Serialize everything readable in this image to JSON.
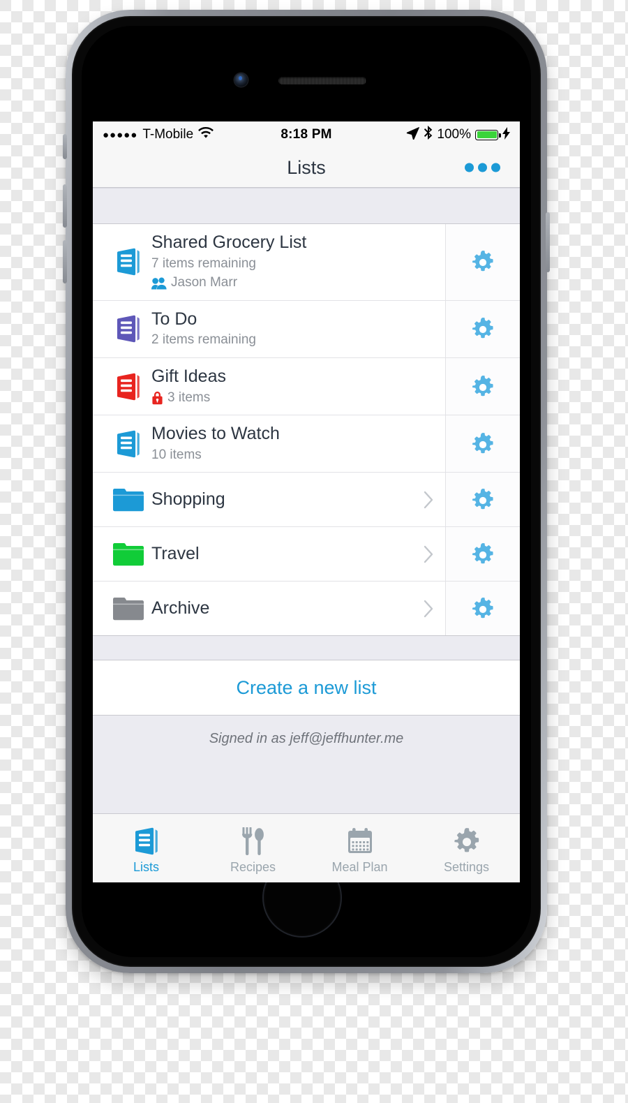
{
  "device": {
    "name": "iPhone",
    "camera_icon": "front-camera",
    "speaker_icon": "earpiece-speaker",
    "home_button_icon": "home-button"
  },
  "status_bar": {
    "signal_dots": "●●●●●",
    "carrier": "T-Mobile",
    "wifi_icon": "wifi-icon",
    "time": "8:18 PM",
    "location_icon": "location-arrow-icon",
    "bluetooth_icon": "bluetooth-icon",
    "battery_percent": "100%",
    "battery_level": 100,
    "battery_color": "#3ad43a",
    "charging_icon": "lightning-bolt-icon"
  },
  "nav_bar": {
    "title": "Lists",
    "more_button_label": "•••",
    "more_icon": "ellipsis-icon",
    "accent_color": "#1c9ad6"
  },
  "rows": [
    {
      "type": "list",
      "name": "Shared Grocery List",
      "subtitle": "7 items remaining",
      "icon": "list-icon",
      "icon_color": "#1c9ad6",
      "shared_icon": "people-icon",
      "shared_with": "Jason Marr",
      "locked": false,
      "has_chevron": false,
      "gear_icon": "gear-icon"
    },
    {
      "type": "list",
      "name": "To Do",
      "subtitle": "2 items remaining",
      "icon": "list-icon",
      "icon_color": "#5e57b8",
      "shared_with": null,
      "locked": false,
      "has_chevron": false,
      "gear_icon": "gear-icon"
    },
    {
      "type": "list",
      "name": "Gift Ideas",
      "subtitle": "3 items",
      "icon": "list-icon",
      "icon_color": "#e8241f",
      "shared_with": null,
      "locked": true,
      "lock_icon": "lock-icon",
      "lock_color": "#e8241f",
      "has_chevron": false,
      "gear_icon": "gear-icon"
    },
    {
      "type": "list",
      "name": "Movies to Watch",
      "subtitle": "10 items",
      "icon": "list-icon",
      "icon_color": "#1c9ad6",
      "shared_with": null,
      "locked": false,
      "has_chevron": false,
      "gear_icon": "gear-icon"
    },
    {
      "type": "folder",
      "name": "Shopping",
      "subtitle": null,
      "icon": "folder-icon",
      "icon_color": "#1c9ad6",
      "has_chevron": true,
      "chevron_icon": "chevron-right-icon",
      "gear_icon": "gear-icon"
    },
    {
      "type": "folder",
      "name": "Travel",
      "subtitle": null,
      "icon": "folder-icon",
      "icon_color": "#11cc38",
      "has_chevron": true,
      "chevron_icon": "chevron-right-icon",
      "gear_icon": "gear-icon"
    },
    {
      "type": "folder",
      "name": "Archive",
      "subtitle": null,
      "icon": "folder-icon",
      "icon_color": "#86898e",
      "has_chevron": true,
      "chevron_icon": "chevron-right-icon",
      "gear_icon": "gear-icon"
    }
  ],
  "create_list": {
    "label": "Create a new list"
  },
  "footer": {
    "signed_in_text": "Signed in as jeff@jeffhunter.me"
  },
  "tab_bar": {
    "active_index": 0,
    "active_color": "#1c9ad6",
    "inactive_color": "#9aa5ad",
    "tabs": [
      {
        "label": "Lists",
        "icon": "list-icon"
      },
      {
        "label": "Recipes",
        "icon": "fork-and-spoon-icon"
      },
      {
        "label": "Meal Plan",
        "icon": "calendar-icon"
      },
      {
        "label": "Settings",
        "icon": "gear-icon"
      }
    ]
  }
}
